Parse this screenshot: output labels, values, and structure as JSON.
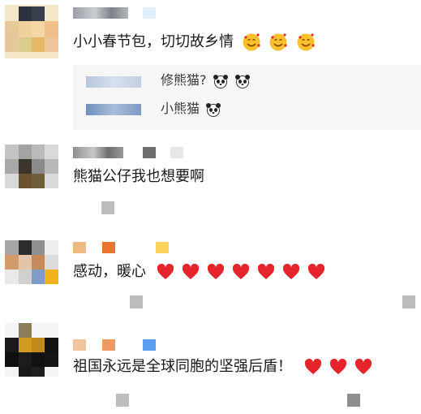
{
  "comments": [
    {
      "text": "小小春节包，切切故乡情",
      "emoji": [
        "smiling-face-with-hearts",
        "smiling-face-with-hearts",
        "smiling-face-with-hearts"
      ],
      "replies": [
        {
          "text": "修熊猫?",
          "emoji": [
            "panda-face",
            "panda-face"
          ]
        },
        {
          "text": "小熊猫",
          "emoji": [
            "panda-face"
          ]
        }
      ]
    },
    {
      "text": "熊猫公仔我也想要啊",
      "emoji": []
    },
    {
      "text": "感动，暖心",
      "emoji": [
        "red-heart",
        "red-heart",
        "red-heart",
        "red-heart",
        "red-heart",
        "red-heart",
        "red-heart"
      ]
    },
    {
      "text": "祖国永远是全球同胞的坚强后盾！",
      "emoji": [
        "red-heart",
        "red-heart",
        "red-heart"
      ]
    }
  ],
  "colors": {
    "heart": "#e5242b",
    "reply_background": "#f6f6f6",
    "text": "#1a1a1a"
  }
}
